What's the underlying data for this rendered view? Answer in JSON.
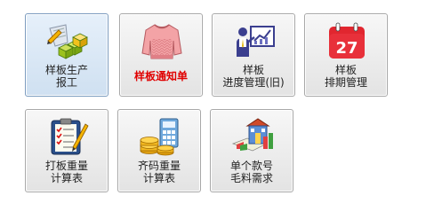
{
  "tiles": [
    {
      "line1": "样板生产",
      "line2": "报工",
      "icon": "blocks-pencil-icon",
      "selected": true
    },
    {
      "line1": "样板通知单",
      "line2": "",
      "icon": "sweater-icon",
      "accent": "#e00000"
    },
    {
      "line1": "样板",
      "line2": "进度管理(旧)",
      "icon": "presenter-chart-icon"
    },
    {
      "line1": "样板",
      "line2": "排期管理",
      "icon": "calendar-icon",
      "calendar_day": "27"
    },
    {
      "line1": "打板重量",
      "line2": "计算表",
      "icon": "clipboard-checklist-icon"
    },
    {
      "line1": "齐码重量",
      "line2": "计算表",
      "icon": "coins-calculator-icon"
    },
    {
      "line1": "单个款号",
      "line2": "毛料需求",
      "icon": "house-chart-icon"
    }
  ]
}
